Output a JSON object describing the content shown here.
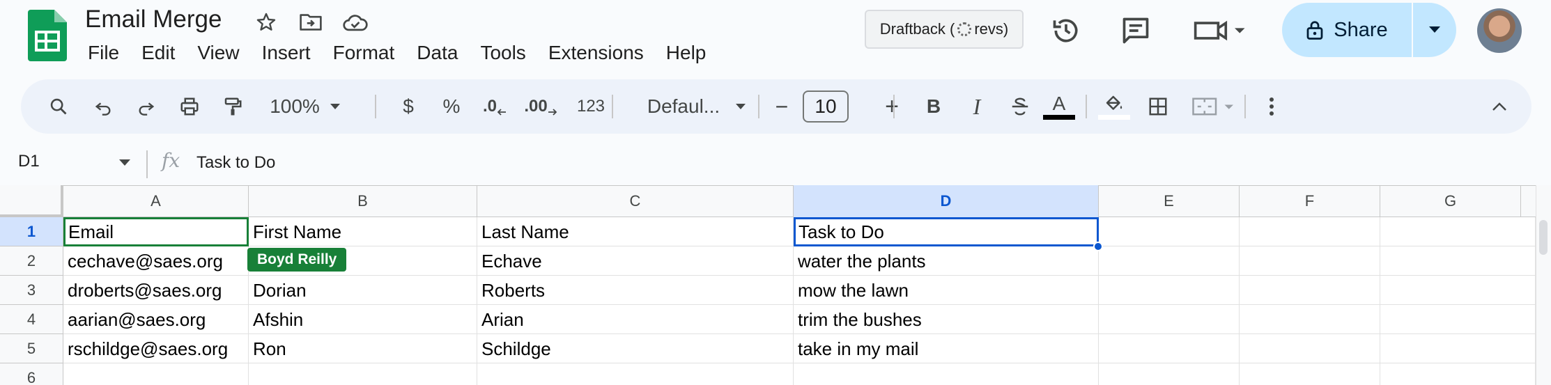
{
  "app": {
    "title": "Email Merge",
    "menu": [
      "File",
      "Edit",
      "View",
      "Insert",
      "Format",
      "Data",
      "Tools",
      "Extensions",
      "Help"
    ]
  },
  "header": {
    "draftback_prefix": "Draftback (",
    "draftback_suffix": "revs)",
    "share_label": "Share"
  },
  "toolbar": {
    "zoom": "100%",
    "currency": "$",
    "percent": "%",
    "dec_decrease": ".0",
    "dec_increase": ".00",
    "number_format": "123",
    "font": "Defaul...",
    "minus": "−",
    "font_size": "10",
    "plus": "+",
    "bold": "B",
    "italic": "I",
    "text_color_letter": "A"
  },
  "formula_bar": {
    "name_box": "D1",
    "fx": "fx",
    "content": "Task to Do"
  },
  "grid": {
    "columns": [
      "A",
      "B",
      "C",
      "D",
      "E",
      "F",
      "G"
    ],
    "row_numbers": [
      "1",
      "2",
      "3",
      "4",
      "5",
      "6"
    ],
    "rows": [
      [
        "Email",
        "First Name",
        "Last Name",
        "Task to Do",
        "",
        "",
        ""
      ],
      [
        "cechave@saes.org",
        "",
        "Echave",
        "water the plants",
        "",
        "",
        ""
      ],
      [
        "droberts@saes.org",
        "Dorian",
        "Roberts",
        "mow the lawn",
        "",
        "",
        ""
      ],
      [
        "aarian@saes.org",
        "Afshin",
        "Arian",
        "trim the bushes",
        "",
        "",
        ""
      ],
      [
        "rschildge@saes.org",
        "Ron",
        "Schildge",
        "take in my mail",
        "",
        "",
        ""
      ],
      [
        "",
        "",
        "",
        "",
        "",
        "",
        ""
      ]
    ],
    "collaborator_tag": "Boyd Reilly"
  },
  "colors": {
    "accent": "#0b57d0",
    "share_bg": "#c2e7ff",
    "collaborator": "#188038",
    "toolbar_bg": "#edf2fa"
  }
}
